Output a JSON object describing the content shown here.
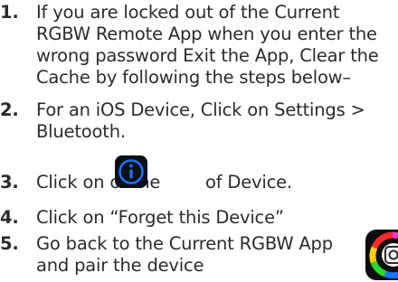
{
  "steps": [
    {
      "number": "1.",
      "lines": [
        "If you are locked out of the Current",
        "RGBW Remote App when you enter the",
        "wrong password Exit the App, Clear the",
        "Cache by following the steps below–"
      ]
    },
    {
      "number": "2.",
      "lines": [
        "For an iOS Device, Click on Settings >",
        "Bluetooth."
      ]
    },
    {
      "number": "3.",
      "before_icon": "Click on of the",
      "after_icon": "of Device.",
      "icon": "info-icon"
    },
    {
      "number": "4.",
      "lines": [
        "Click on “Forget this Device”"
      ]
    },
    {
      "number": "5.",
      "lines": [
        "Go back to the Current RGBW App",
        "and pair the device"
      ],
      "icon": "rgbw-app-icon"
    }
  ],
  "colors": {
    "text": "#2b2b2b",
    "info_icon_bg": "#0b0f17",
    "info_icon_accent": "#1e73ff"
  }
}
